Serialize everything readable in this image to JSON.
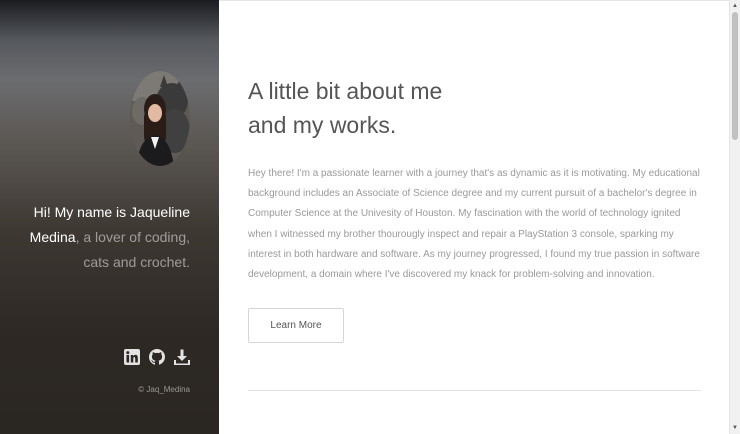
{
  "sidebar": {
    "name_highlight": "Hi! My name is Jaqueline Medina",
    "tagline": ", a lover of coding, cats and crochet.",
    "socials": [
      {
        "icon": "linkedin-icon"
      },
      {
        "icon": "github-icon"
      },
      {
        "icon": "download-icon"
      }
    ],
    "copyright": "© Jaq_Medina"
  },
  "main": {
    "headline_line1": "A little bit about me",
    "headline_line2": "and my works.",
    "about": "Hey there! I'm a passionate learner with a journey that's as dynamic as it is motivating. My educational background includes an Associate of Science degree and my current pursuit of a bachelor's degree in Computer Science at the Univesity of Houston. My fascination with the world of technology ignited when I witnessed my brother thourougly inspect and repair a PlayStation 3 console, sparking my interest in both hardware and software. As my journey progressed, I found my true passion in software development, a domain where I've discovered my knack for problem-solving and innovation.",
    "learn_more": "Learn More"
  },
  "scrollbar": {
    "up_arrow": "▲",
    "down_arrow": "▼"
  }
}
